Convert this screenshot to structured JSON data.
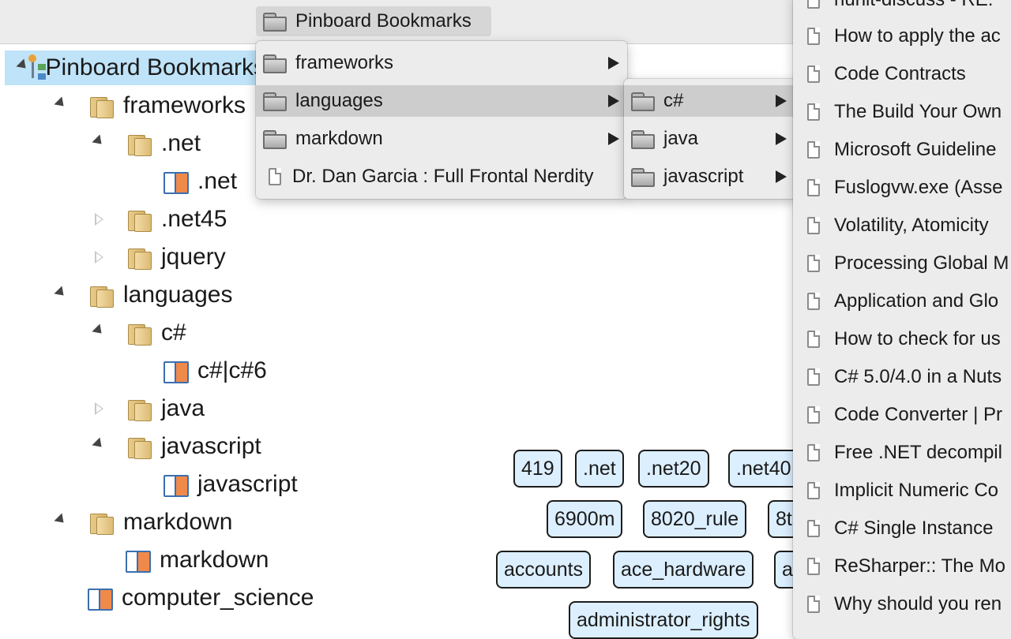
{
  "toolbar": {
    "button_label": "Pinboard Bookmarks"
  },
  "tree": {
    "root": "Pinboard Bookmarks",
    "items": [
      {
        "label": "frameworks"
      },
      {
        "label": ".net"
      },
      {
        "label": ".net"
      },
      {
        "label": ".net45"
      },
      {
        "label": "jquery"
      },
      {
        "label": "languages"
      },
      {
        "label": "c#"
      },
      {
        "label": "c#|c#6"
      },
      {
        "label": "java"
      },
      {
        "label": "javascript"
      },
      {
        "label": "javascript"
      },
      {
        "label": "markdown"
      },
      {
        "label": "markdown"
      },
      {
        "label": "computer_science"
      }
    ]
  },
  "menu1": {
    "items": [
      {
        "label": "frameworks"
      },
      {
        "label": "languages"
      },
      {
        "label": "markdown"
      },
      {
        "label": "Dr. Dan Garcia : Full Frontal Nerdity"
      }
    ]
  },
  "menu2": {
    "items": [
      {
        "label": "c#"
      },
      {
        "label": "java"
      },
      {
        "label": "javascript"
      }
    ]
  },
  "menu3": {
    "items": [
      {
        "label": "nunit-discuss - RE:"
      },
      {
        "label": "How to apply the ac"
      },
      {
        "label": "Code Contracts"
      },
      {
        "label": "The Build Your Own"
      },
      {
        "label": "Microsoft Guideline"
      },
      {
        "label": "Fuslogvw.exe (Asse"
      },
      {
        "label": "Volatility, Atomicity"
      },
      {
        "label": "Processing Global M"
      },
      {
        "label": "Application and Glo"
      },
      {
        "label": "How to check for us"
      },
      {
        "label": "C# 5.0/4.0 in a Nuts"
      },
      {
        "label": "Code Converter | Pr"
      },
      {
        "label": "Free .NET decompil"
      },
      {
        "label": "Implicit Numeric Co"
      },
      {
        "label": "C# Single Instance"
      },
      {
        "label": "ReSharper:: The Mo"
      },
      {
        "label": "Why should you ren"
      }
    ]
  },
  "tags": [
    {
      "label": "419"
    },
    {
      "label": ".net"
    },
    {
      "label": ".net20"
    },
    {
      "label": ".net40"
    },
    {
      "label": "6900m"
    },
    {
      "label": "8020_rule"
    },
    {
      "label": "8t"
    },
    {
      "label": "accounts"
    },
    {
      "label": "ace_hardware"
    },
    {
      "label": "a"
    },
    {
      "label": "administrator_rights"
    }
  ]
}
